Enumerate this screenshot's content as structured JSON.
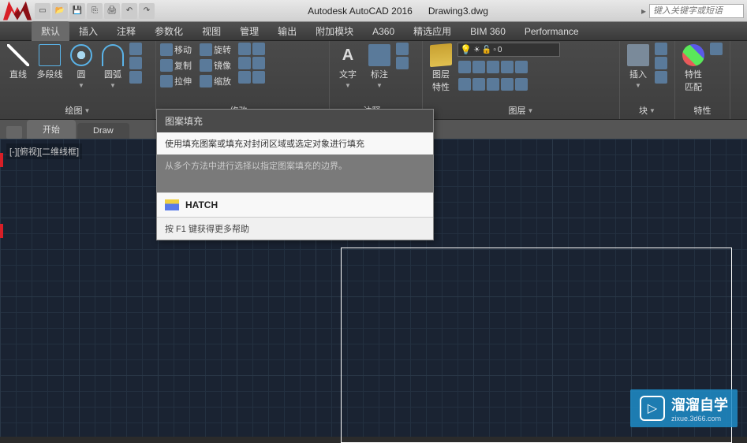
{
  "title_bar": {
    "app_name": "Autodesk AutoCAD 2016",
    "file_name": "Drawing3.dwg",
    "search_placeholder": "键入关键字或短语"
  },
  "menu_tabs": [
    "默认",
    "插入",
    "注释",
    "参数化",
    "视图",
    "管理",
    "输出",
    "附加模块",
    "A360",
    "精选应用",
    "BIM 360",
    "Performance"
  ],
  "ribbon": {
    "draw": {
      "title": "绘图",
      "line": "直线",
      "polyline": "多段线",
      "circle": "圆",
      "arc": "圆弧"
    },
    "modify": {
      "title": "修改",
      "move": "移动",
      "copy": "复制",
      "stretch": "拉伸",
      "rotate": "旋转",
      "mirror": "镜像",
      "scale": "缩放"
    },
    "annotation": {
      "title": "注释",
      "text": "文字",
      "dim": "标注"
    },
    "layers": {
      "title": "图层",
      "props": "图层\n特性",
      "current": "0"
    },
    "block": {
      "title": "块",
      "insert": "插入"
    },
    "properties": {
      "title": "特性",
      "match": "特性\n匹配"
    }
  },
  "doc_tabs": {
    "start": "开始",
    "drawing": "Draw"
  },
  "viewport": {
    "label": "[-][俯视][二维线框]"
  },
  "tooltip": {
    "title": "图案填充",
    "desc": "使用填充图案或填充对封闭区域或选定对象进行填充",
    "hint": "从多个方法中进行选择以指定图案填充的边界。",
    "command": "HATCH",
    "help": "按 F1 键获得更多帮助"
  },
  "watermark": {
    "main": "溜溜自学",
    "sub": "zixue.3d66.com"
  }
}
